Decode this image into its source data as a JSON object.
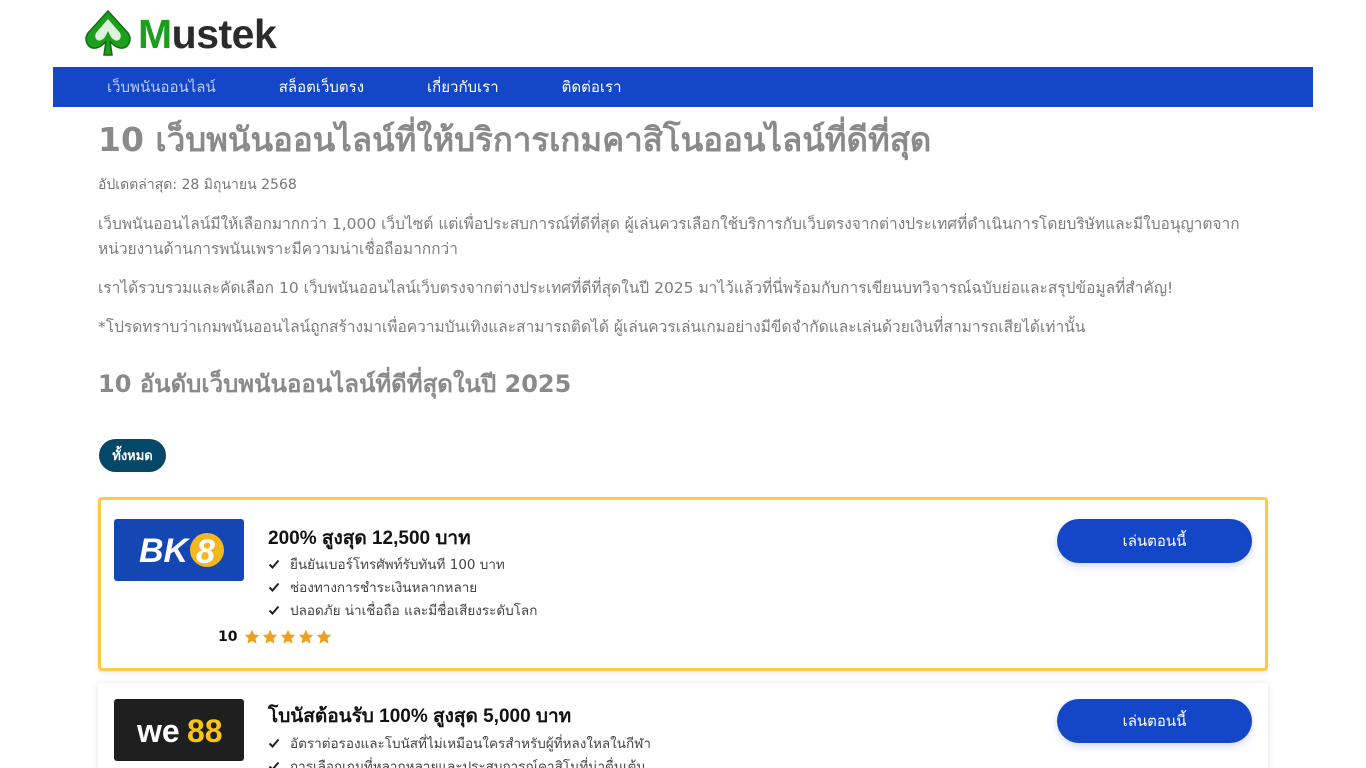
{
  "logo": {
    "text_m": "M",
    "text_rest": "ustek",
    "color_m": "#1e9e1e",
    "color_rest": "#2b2b2b"
  },
  "nav": {
    "items": [
      {
        "label": "เว็บพนันออนไลน์",
        "active": true
      },
      {
        "label": "สล็อตเว็บตรง",
        "active": false
      },
      {
        "label": "เกี่ยวกับเรา",
        "active": false
      },
      {
        "label": "ติดต่อเรา",
        "active": false
      }
    ],
    "bg_color": "#1446c8"
  },
  "page": {
    "title": "10 เว็บพนันออนไลน์ที่ให้บริการเกมคาสิโนออนไลน์ที่ดีที่สุด",
    "updated": "อัปเดตล่าสุด: 28 มิถุนายน 2568",
    "paragraphs": [
      "เว็บพนันออนไลน์มีให้เลือกมากกว่า 1,000 เว็บไซต์ แต่เพื่อประสบการณ์ที่ดีที่สุด ผู้เล่นควรเลือกใช้บริการกับเว็บตรงจากต่างประเทศที่ดำเนินการโดยบริษัทและมีใบอนุญาตจากหน่วยงานด้านการพนันเพราะมีความน่าเชื่อถือมากกว่า",
      "เราได้รวบรวมและคัดเลือก 10 เว็บพนันออนไลน์เว็บตรงจากต่างประเทศที่ดีที่สุดในปี 2025 มาไว้แล้วที่นี่พร้อมกับการเขียนบทวิจารณ์ฉบับย่อและสรุปข้อมูลที่สำคัญ!",
      "*โปรดทราบว่าเกมพนันออนไลน์ถูกสร้างมาเพื่อความบันเทิงและสามารถติดได้ ผู้เล่นควรเล่นเกมอย่างมีขีดจำกัดและเล่นด้วยเงินที่สามารถเสียได้เท่านั้น"
    ],
    "subtitle": "10 อันดับเว็บพนันออนไลน์ที่ดีที่สุดในปี 2025",
    "filter_label": "ทั้งหมด"
  },
  "cards": [
    {
      "brand": "BK8",
      "bonus": "200% สูงสุด 12,500 บาท",
      "features": [
        "ยืนยันเบอร์โทรศัพท์รับทันที 100 บาท",
        "ช่องทางการชำระเงินหลากหลาย",
        "ปลอดภัย น่าเชื่อถือ และมีชื่อเสียงระดับโลก"
      ],
      "rating": "10",
      "stars": 5,
      "cta": "เล่นตอนนี้",
      "border_color": "#fcca45"
    },
    {
      "brand": "we88",
      "bonus": "โบนัสต้อนรับ 100% สูงสุด 5,000 บาท",
      "features": [
        "อัตราต่อรองและโบนัสที่ไม่เหมือนใครสำหรับผู้ที่หลงใหลในกีฬา",
        "การเลือกเกมที่หลากหลายและประสบการณ์คาสิโนที่น่าตื่นเต้น"
      ],
      "cta": "เล่นตอนนี้"
    }
  ],
  "colors": {
    "accent": "#1446c8",
    "star": "#f0a020",
    "filter": "#054768"
  }
}
